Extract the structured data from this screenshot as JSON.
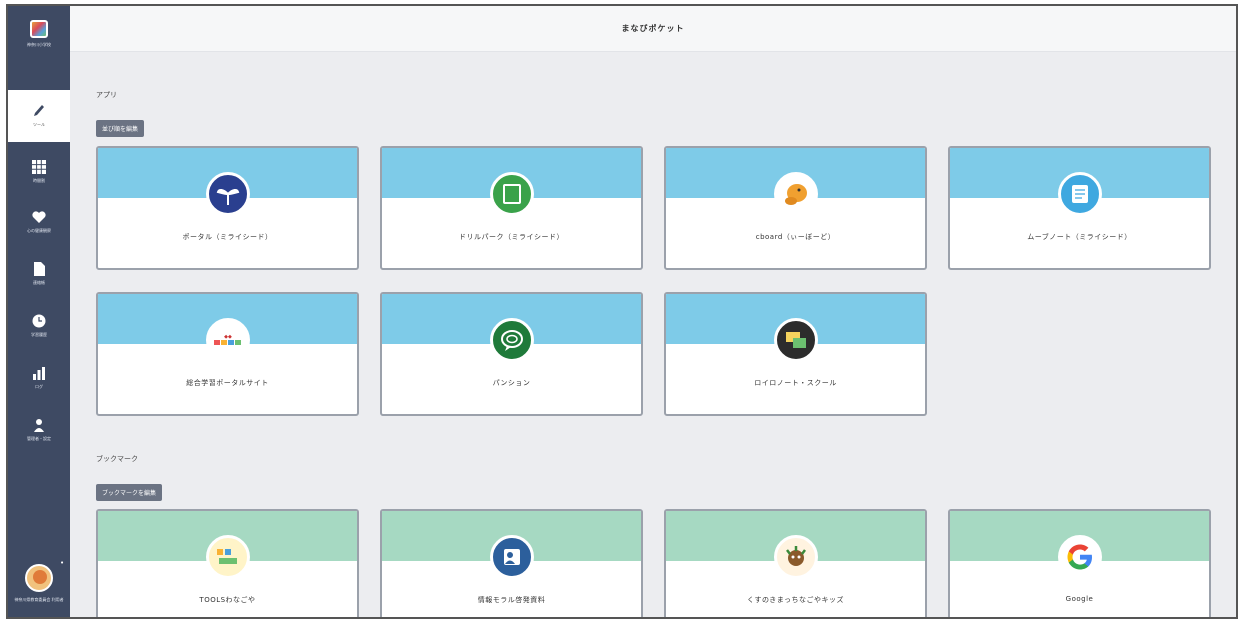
{
  "header": {
    "title": "まなびポケット"
  },
  "sidebar": {
    "items": [
      {
        "label": "神奈川小学校",
        "icon": "school-logo-icon"
      },
      {
        "label": "ツール",
        "icon": "pen-icon",
        "active": true
      },
      {
        "label": "時間割",
        "icon": "grid-icon"
      },
      {
        "label": "心の健康観察",
        "icon": "heart-icon"
      },
      {
        "label": "連絡帳",
        "icon": "document-icon"
      },
      {
        "label": "学習履歴",
        "icon": "clock-icon"
      },
      {
        "label": "ログ",
        "icon": "chart-icon"
      },
      {
        "label": "管理者・設定",
        "icon": "person-icon"
      }
    ],
    "user": {
      "label": "神奈川県教育委員会 利用者",
      "dot": "•"
    }
  },
  "apps": {
    "section_label": "アプリ",
    "edit_label": "並び順を編集",
    "cards": [
      {
        "name": "ポータル（ミライシード）",
        "icon": "miraiseed-portal-icon",
        "color": "#2a3f8f"
      },
      {
        "name": "ドリルパーク（ミライシード）",
        "icon": "drill-park-icon",
        "color": "#3aa24a"
      },
      {
        "name": "cboard（ぃーぼーど）",
        "icon": "cboard-character-icon",
        "color": "#f0a030"
      },
      {
        "name": "ムーブノート（ミライシード）",
        "icon": "move-note-icon",
        "color": "#3fa8e0"
      },
      {
        "name": "総合学習ポータルサイト",
        "icon": "learning-portal-logo-icon",
        "color": "#ffffff"
      },
      {
        "name": "パンション",
        "icon": "chat-bubble-icon",
        "color": "#1f7a3a"
      },
      {
        "name": "ロイロノート・スクール",
        "icon": "loilo-note-icon",
        "color": "#2c2c2c"
      }
    ]
  },
  "bookmarks": {
    "section_label": "ブックマーク",
    "edit_label": "ブックマークを編集",
    "cards": [
      {
        "name": "TOOLSわなごや",
        "icon": "tools-nagoya-logo-icon",
        "color": "#fff4c8"
      },
      {
        "name": "情報モラル啓発資料",
        "icon": "info-moral-icon",
        "color": "#2c5f9c"
      },
      {
        "name": "くすのきまっちなごやキッズ",
        "icon": "nagoya-kids-character-icon",
        "color": "#fff3e0"
      },
      {
        "name": "Google",
        "icon": "google-logo-icon",
        "color": "#ffffff"
      }
    ]
  }
}
